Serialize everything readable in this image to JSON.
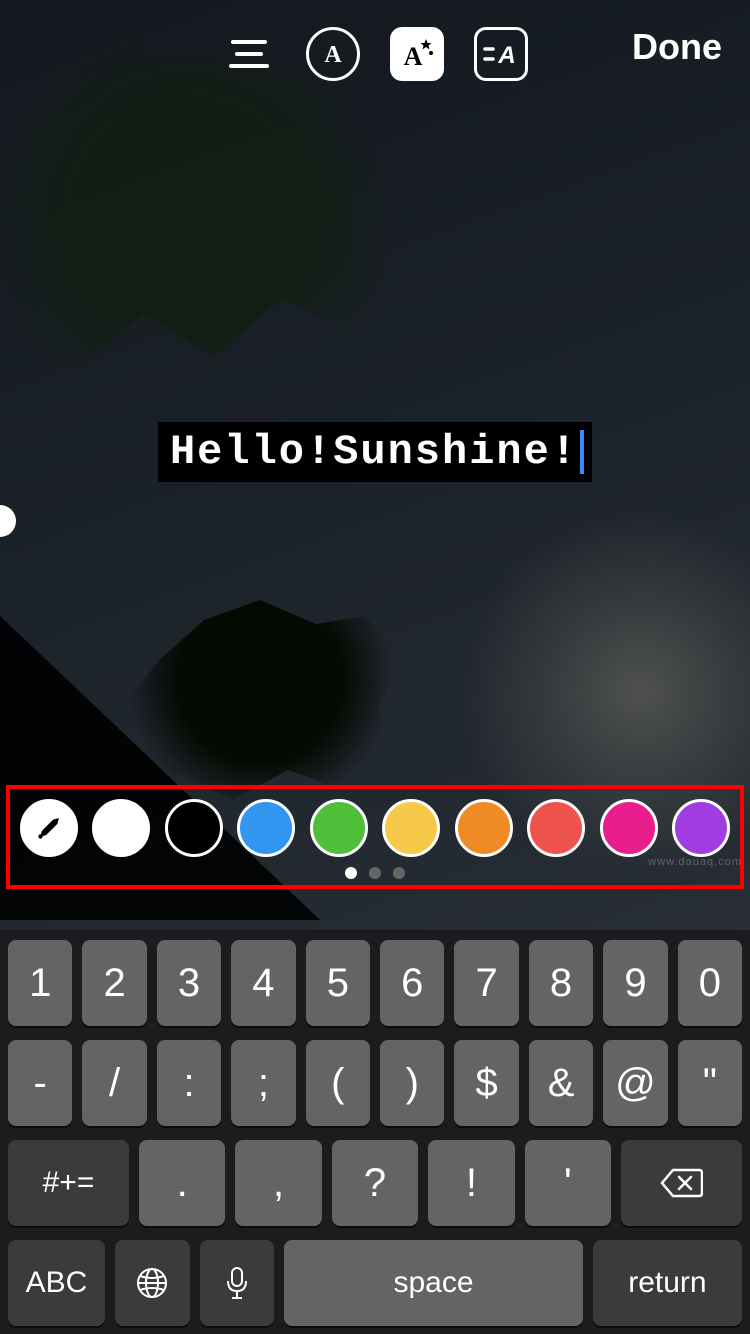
{
  "toolbar": {
    "done_label": "Done"
  },
  "text_overlay": {
    "content": "Hello!Sunshine!"
  },
  "palette": {
    "colors": [
      "#ffffff",
      "#000000",
      "#3296f0",
      "#4fbf3a",
      "#f7c948",
      "#f08a24",
      "#ef5350",
      "#e91e8c",
      "#a03de0"
    ],
    "page_dots": 3,
    "active_dot": 0
  },
  "keyboard": {
    "row1": [
      "1",
      "2",
      "3",
      "4",
      "5",
      "6",
      "7",
      "8",
      "9",
      "0"
    ],
    "row2": [
      "-",
      "/",
      ":",
      ";",
      "(",
      ")",
      "$",
      "&",
      "@",
      "\""
    ],
    "row3_shift": "#+=",
    "row3": [
      ".",
      ",",
      "?",
      "!",
      "'"
    ],
    "bottom": {
      "abc": "ABC",
      "space": "space",
      "return": "return"
    }
  },
  "watermark": "www.dauaq.com"
}
